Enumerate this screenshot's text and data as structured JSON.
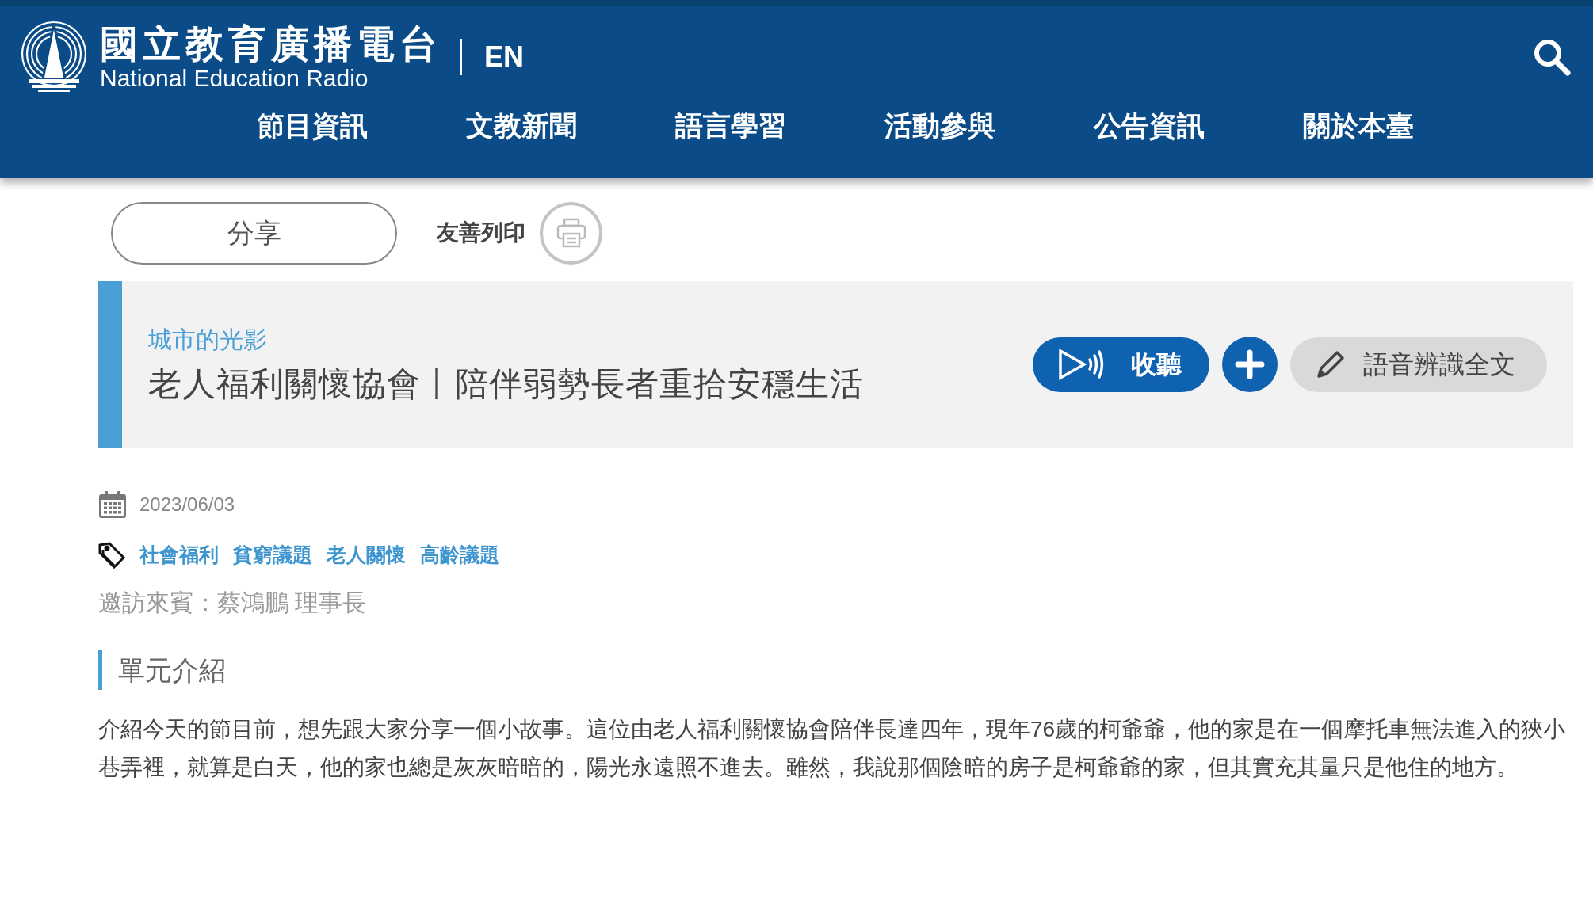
{
  "header": {
    "logo_title": "國立教育廣播電台",
    "logo_subtitle": "National Education Radio",
    "language_link": "EN"
  },
  "nav": [
    "節目資訊",
    "文教新聞",
    "語言學習",
    "活動參與",
    "公告資訊",
    "關於本臺"
  ],
  "toolbar": {
    "share_button": "分享",
    "print_label": "友善列印"
  },
  "program": {
    "category": "城市的光影",
    "title": "老人福利關懷協會丨陪伴弱勢長者重拾安穩生活",
    "listen_button": "收聽",
    "transcript_button": "語音辨識全文"
  },
  "meta": {
    "date": "2023/06/03",
    "tags": [
      "社會福利",
      "貧窮議題",
      "老人關懷",
      "高齡議題"
    ],
    "guest": "邀訪來賓：蔡鴻鵬 理事長"
  },
  "section": {
    "heading": "單元介紹",
    "body": "介紹今天的節目前，想先跟大家分享一個小故事。這位由老人福利關懷協會陪伴長達四年，現年76歲的柯爺爺，他的家是在一個摩托車無法進入的狹小巷弄裡，就算是白天，他的家也總是灰灰暗暗的，陽光永遠照不進去。雖然，我說那個陰暗的房子是柯爺爺的家，但其實充其量只是他住的地方。"
  }
}
